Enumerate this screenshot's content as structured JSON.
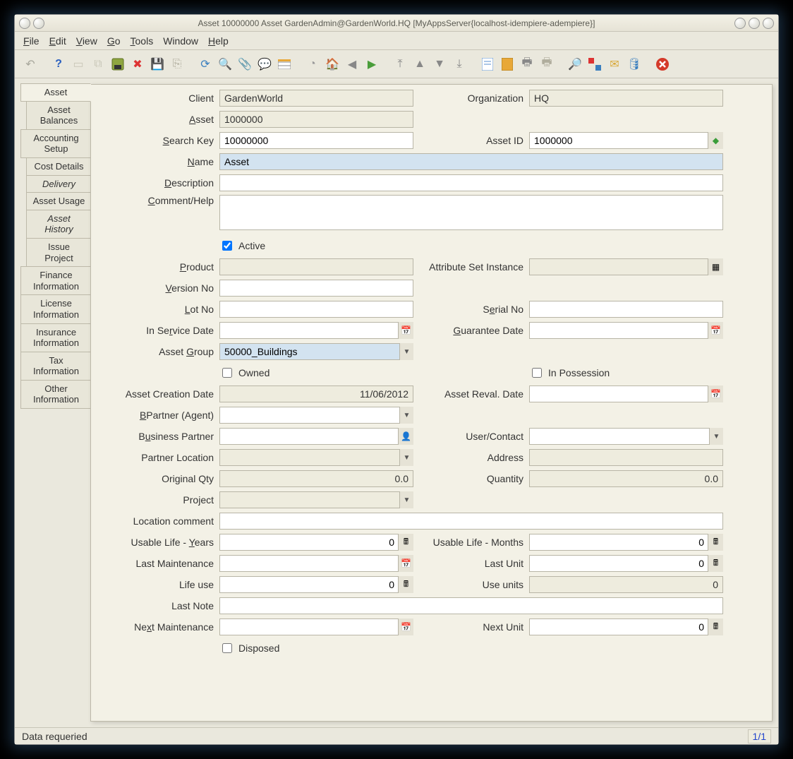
{
  "title": "Asset  10000000  Asset  GardenAdmin@GardenWorld.HQ [MyAppsServer{localhost-idempiere-adempiere}]",
  "menu": {
    "file": "File",
    "edit": "Edit",
    "view": "View",
    "go": "Go",
    "tools": "Tools",
    "window": "Window",
    "help": "Help"
  },
  "tabs": [
    "Asset",
    "Asset Balances",
    "Accounting Setup",
    "Cost Details",
    "Delivery",
    "Asset Usage",
    "Asset History",
    "Issue Project",
    "Finance Information",
    "License Information",
    "Insurance Information",
    "Tax Information",
    "Other Information"
  ],
  "labels": {
    "client": "Client",
    "organization": "Organization",
    "asset": "Asset",
    "search_key": "Search Key",
    "asset_id": "Asset ID",
    "name": "Name",
    "description": "Description",
    "comment": "Comment/Help",
    "active": "Active",
    "product": "Product",
    "attr_set": "Attribute Set Instance",
    "version_no": "Version No",
    "lot_no": "Lot No",
    "serial_no": "Serial No",
    "in_service": "In Service Date",
    "guarantee": "Guarantee Date",
    "asset_group": "Asset Group",
    "owned": "Owned",
    "in_possession": "In Possession",
    "creation_date": "Asset Creation Date",
    "reval_date": "Asset Reval. Date",
    "bpartner_agent": "BPartner (Agent)",
    "business_partner": "Business Partner",
    "user_contact": "User/Contact",
    "partner_location": "Partner Location",
    "address": "Address",
    "original_qty": "Original Qty",
    "quantity": "Quantity",
    "project": "Project",
    "location_comment": "Location comment",
    "usable_life_years": "Usable Life - Years",
    "usable_life_months": "Usable Life - Months",
    "last_maintenance": "Last Maintenance",
    "last_unit": "Last Unit",
    "life_use": "Life use",
    "use_units": "Use units",
    "last_note": "Last Note",
    "next_maintenance": "Next Maintenance",
    "next_unit": "Next Unit",
    "disposed": "Disposed"
  },
  "values": {
    "client": "GardenWorld",
    "organization": "HQ",
    "asset": "1000000",
    "search_key": "10000000",
    "asset_id": "1000000",
    "name": "Asset",
    "description": "",
    "comment": "",
    "active": true,
    "product": "",
    "attr_set": "",
    "version_no": "",
    "lot_no": "",
    "serial_no": "",
    "in_service": "",
    "guarantee": "",
    "asset_group": "50000_Buildings",
    "owned": false,
    "in_possession": false,
    "creation_date": "11/06/2012",
    "reval_date": "",
    "bpartner_agent": "",
    "business_partner": "",
    "user_contact": "",
    "partner_location": "",
    "address": "",
    "original_qty": "0.0",
    "quantity": "0.0",
    "project": "",
    "location_comment": "",
    "usable_life_years": "0",
    "usable_life_months": "0",
    "last_maintenance": "",
    "last_unit": "0",
    "life_use": "0",
    "use_units": "0",
    "last_note": "",
    "next_maintenance": "",
    "next_unit": "0",
    "disposed": false
  },
  "status": {
    "message": "Data requeried",
    "pager": "1/1"
  }
}
